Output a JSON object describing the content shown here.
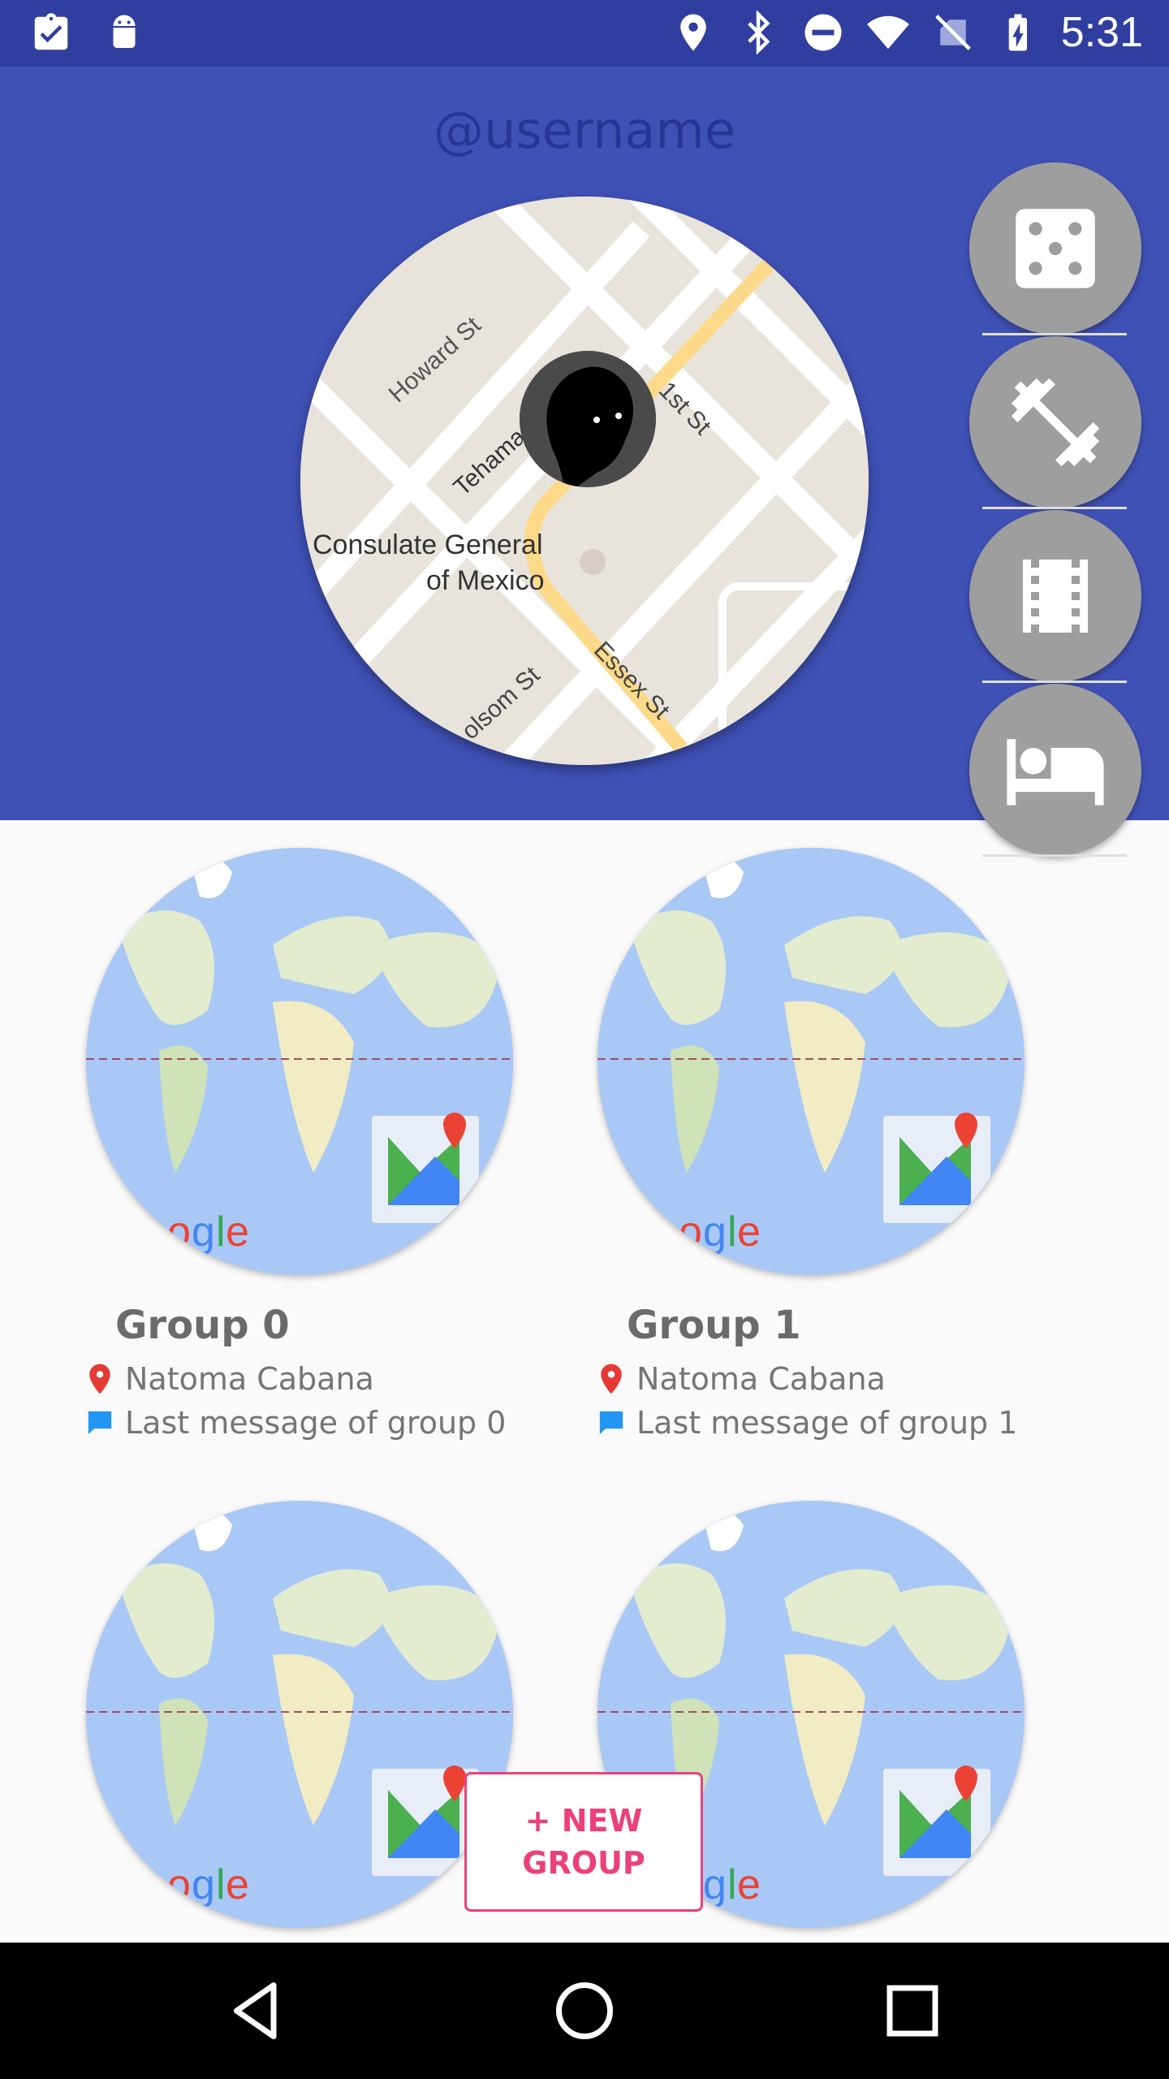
{
  "status_bar": {
    "time": "5:31",
    "left_icons": [
      "clipboard-check-icon",
      "android-icon"
    ],
    "right_icons": [
      "location-pin-icon",
      "bluetooth-icon",
      "do-not-disturb-icon",
      "wifi-icon",
      "no-sim-icon",
      "battery-charging-icon"
    ]
  },
  "header": {
    "username": "@username",
    "map_labels": {
      "howard": "Howard St",
      "tehama": "Tehama",
      "first": "1st St",
      "consulate_line1": "Consulate General",
      "consulate_line2": "of Mexico",
      "folsom": "olsom St",
      "essex": "Essex St"
    },
    "category_buttons": [
      "dice-icon",
      "dumbbell-icon",
      "film-icon",
      "bed-icon"
    ]
  },
  "groups": [
    {
      "name": "Group 0",
      "location": "Natoma Cabana",
      "last_message": "Last message of group 0"
    },
    {
      "name": "Group 1",
      "location": "Natoma Cabana",
      "last_message": "Last message of group 1"
    }
  ],
  "new_group_button": {
    "line1": "+ NEW",
    "line2": "GROUP"
  },
  "colors": {
    "status_bar": "#303f9f",
    "header": "#3f51b5",
    "accent": "#ec407a",
    "fab": "#9e9e9e",
    "background": "#fafafa"
  }
}
